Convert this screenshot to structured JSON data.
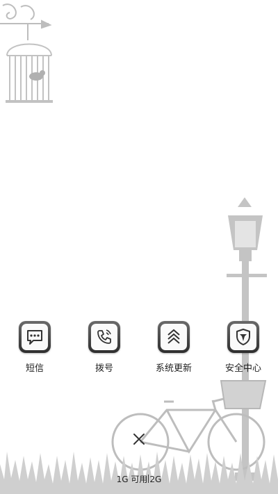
{
  "apps": [
    {
      "label": "短信",
      "icon": "message-icon"
    },
    {
      "label": "拨号",
      "icon": "phone-icon"
    },
    {
      "label": "系统更新",
      "icon": "system-update-icon"
    },
    {
      "label": "安全中心",
      "icon": "security-shield-icon"
    }
  ],
  "memory": {
    "available": "1G 可用",
    "total": "2G"
  },
  "colors": {
    "wallpaper_gray": "#b9b9b9",
    "icon_frame": "#3a3a3a"
  },
  "close_icon": "close-icon"
}
